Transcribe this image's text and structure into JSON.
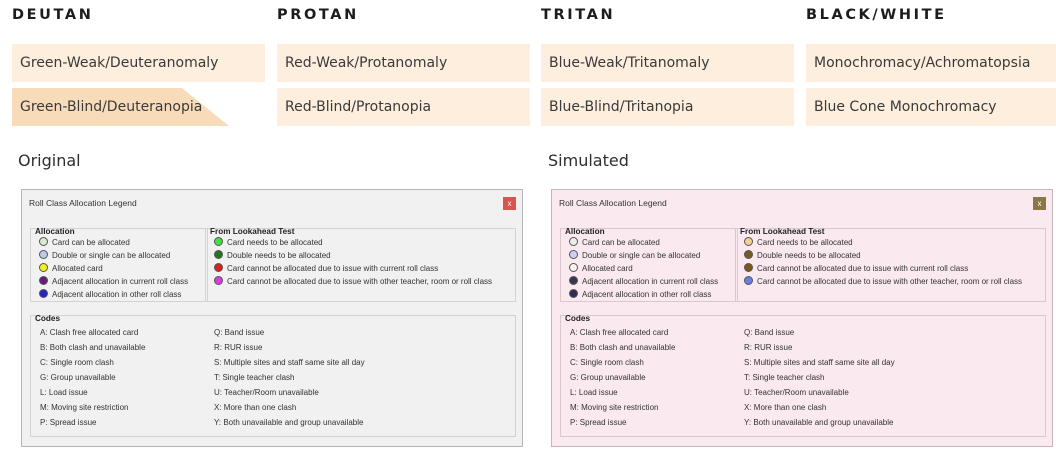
{
  "categories": [
    {
      "title": "DEUTAN",
      "options": [
        "Green-Weak/Deuteranomaly",
        "Green-Blind/Deuteranopia"
      ],
      "active": 1
    },
    {
      "title": "PROTAN",
      "options": [
        "Red-Weak/Protanomaly",
        "Red-Blind/Protanopia"
      ],
      "active": -1
    },
    {
      "title": "TRITAN",
      "options": [
        "Blue-Weak/Tritanomaly",
        "Blue-Blind/Tritanopia"
      ],
      "active": -1
    },
    {
      "title": "BLACK/WHITE",
      "options": [
        "Monochromacy/Achromatopsia",
        "Blue Cone Monochromacy"
      ],
      "active": -1
    }
  ],
  "labels": {
    "original": "Original",
    "simulated": "Simulated"
  },
  "window": {
    "title": "Roll Class Allocation Legend",
    "close": "x",
    "allocation_title": "Allocation",
    "lookahead_title": "From Lookahead Test",
    "codes_title": "Codes",
    "allocation": [
      "Card can be allocated",
      "Double or single can be allocated",
      "Allocated card",
      "Adjacent allocation in current roll class",
      "Adjacent allocation in other roll class"
    ],
    "lookahead": [
      "Card needs to be allocated",
      "Double needs to be allocated",
      "Card cannot be allocated due to issue with current roll class",
      "Card cannot be allocated due to issue with other teacher, room or roll class"
    ],
    "codes_left": [
      "A: Clash free allocated card",
      "B: Both clash and unavailable",
      "C: Single room clash",
      "G: Group unavailable",
      "L: Load issue",
      "M: Moving site restriction",
      "P: Spread issue"
    ],
    "codes_right": [
      "Q: Band issue",
      "R: RUR issue",
      "S: Multiple sites and staff same site all day",
      "T: Single teacher clash",
      "U: Teacher/Room unavailable",
      "X: More than one clash",
      "Y: Both unavailable and group unavailable"
    ]
  },
  "colors": {
    "original_allocation": [
      "#d8ead0",
      "#b9cbe8",
      "#f2f21a",
      "#6a1a78",
      "#2424c8"
    ],
    "original_lookahead": [
      "#3ee43e",
      "#1f7a1f",
      "#d82020",
      "#e03adf"
    ],
    "simulated_allocation": [
      "#f1ece9",
      "#cfd0f5",
      "#fbf6f2",
      "#3a3550",
      "#2f2d57"
    ],
    "simulated_lookahead": [
      "#f6cf8f",
      "#7b5a25",
      "#7a5a1c",
      "#6b7fe0"
    ]
  }
}
